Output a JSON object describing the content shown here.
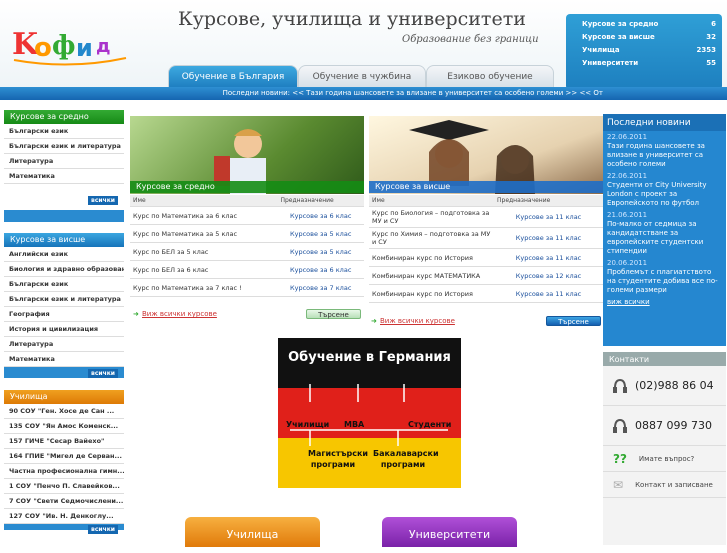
{
  "header": {
    "site_title": "Курсове, училища и университети",
    "subtitle": "Образование без граници",
    "stats": [
      {
        "label": "Курсове за средно",
        "value": "6"
      },
      {
        "label": "Курсове за висше",
        "value": "32"
      },
      {
        "label": "Училища",
        "value": "2353"
      },
      {
        "label": "Университети",
        "value": "55"
      }
    ],
    "tabs": [
      "Обучение в България",
      "Обучение в чужбина",
      "Езиково обучение"
    ]
  },
  "newsbar": "Последни новини:  << Тази година шансовете за влизане в университет са особено големи >>  << От",
  "sidebar": {
    "secondary": {
      "title": "Курсове за средно",
      "items": [
        "Български език",
        "Български език и литература",
        "Литература",
        "Математика"
      ],
      "all": "всички"
    },
    "higher": {
      "title": "Курсове за висше",
      "items": [
        "Английски език",
        "Биология и здравно образован...",
        "Български език",
        "Български език и литература",
        "География",
        "История и цивилизация",
        "Литература",
        "Математика"
      ],
      "all": "всички"
    },
    "schools": {
      "title": "Училища",
      "items": [
        "90 СОУ \"Ген. Хосе де Сан ...",
        "135 СОУ \"Ян Амос Коменск...",
        "157 ГИЧЕ \"Сесар Вайехо\"",
        "164 ГПИЕ \"Мигел де Серван...",
        "Частна професионална гимн...",
        "1 СОУ \"Пенчо П. Славейков...",
        "7 СОУ \"Свети Седмочислени...",
        "127 СОУ \"Ив. Н. Денкоглу..."
      ],
      "all": "всички"
    }
  },
  "courses_secondary": {
    "title": "Курсове за средно",
    "col_name": "Име",
    "col_subject": "Предназначение",
    "rows": [
      [
        "Курс по Математика за 6 клас",
        "Курсове за 6 клас"
      ],
      [
        "Курс по Математика за 5 клас",
        "Курсове за 5 клас"
      ],
      [
        "Курс по БЕЛ за 5 клас",
        "Курсове за 5 клас"
      ],
      [
        "Курс по БЕЛ за 6 клас",
        "Курсове за 6 клас"
      ],
      [
        "Курс по Математика за 7 клас !",
        "Курсове за 7 клас"
      ]
    ],
    "more": "Виж всички курсове",
    "search": "Търсене"
  },
  "courses_higher": {
    "title": "Курсове за висше",
    "col_name": "Име",
    "col_subject": "Предназначение",
    "rows": [
      [
        "Курс по Биология – подготовка за МУ и СУ",
        "Курсове за 11 клас"
      ],
      [
        "Курс по Химия – подготовка за МУ и СУ",
        "Курсове за 11 клас"
      ],
      [
        "Комбиниран курс по История",
        "Курсове за 11 клас"
      ],
      [
        "Комбиниран курс МАТЕМАТИКА",
        "Курсове за 12 клас"
      ],
      [
        "Комбиниран курс по История",
        "Курсове за 11 клас"
      ]
    ],
    "more": "Виж всички курсове",
    "search": "Търсене"
  },
  "ad": {
    "title": "Обучение в Германия",
    "items": [
      "Училищи",
      "MBA",
      "Студенти"
    ],
    "bottom": [
      "Магистърски програми",
      "Бакалаварски програми"
    ]
  },
  "news": {
    "title": "Последни новини",
    "items": [
      {
        "date": "22.06.2011",
        "text": "Тази година шансовете за влизане в университет са особено големи"
      },
      {
        "date": "22.06.2011",
        "text": "Студенти от City University London с проект за Европейското по футбол"
      },
      {
        "date": "21.06.2011",
        "text": "По-малко от седмица за кандидатстване за европейските студентски стипендии"
      },
      {
        "date": "20.06.2011",
        "text": "Проблемът с плагиатството на студентите добива все по-големи размери"
      }
    ],
    "more": "виж всички"
  },
  "contacts": {
    "title": "Контакти",
    "phone1": "(02)988 86 04",
    "phone2": "0887 099 730",
    "question": "Имате въпрос?",
    "contact": "Контакт и записване"
  },
  "bottom": {
    "schools": "Училища",
    "universities": "Университети"
  }
}
